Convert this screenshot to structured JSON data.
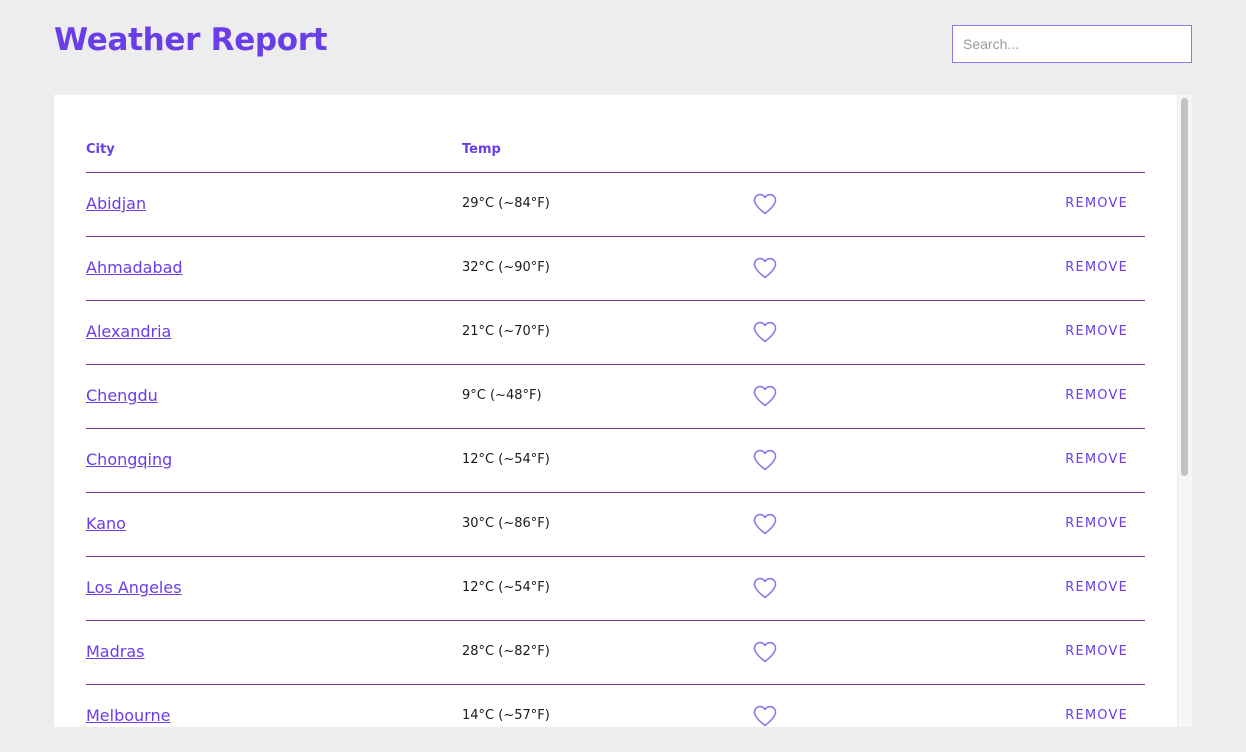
{
  "header": {
    "title": "Weather Report",
    "search_placeholder": "Search..."
  },
  "colors": {
    "accent": "#6a3de8",
    "divider": "#7b3b9e",
    "heart": "#8e78ea",
    "background": "#ededed"
  },
  "table": {
    "columns": [
      "City",
      "Temp"
    ],
    "remove_label": "REMOVE",
    "favorite_icon": "heart-icon",
    "rows": [
      {
        "city": "Abidjan",
        "temp": "29°C (~84°F)"
      },
      {
        "city": "Ahmadabad",
        "temp": "32°C (~90°F)"
      },
      {
        "city": "Alexandria",
        "temp": "21°C (~70°F)"
      },
      {
        "city": "Chengdu",
        "temp": "9°C (~48°F)"
      },
      {
        "city": "Chongqing",
        "temp": "12°C (~54°F)"
      },
      {
        "city": "Kano",
        "temp": "30°C (~86°F)"
      },
      {
        "city": "Los Angeles",
        "temp": "12°C (~54°F)"
      },
      {
        "city": "Madras",
        "temp": "28°C (~82°F)"
      },
      {
        "city": "Melbourne",
        "temp": "14°C (~57°F)"
      }
    ]
  }
}
